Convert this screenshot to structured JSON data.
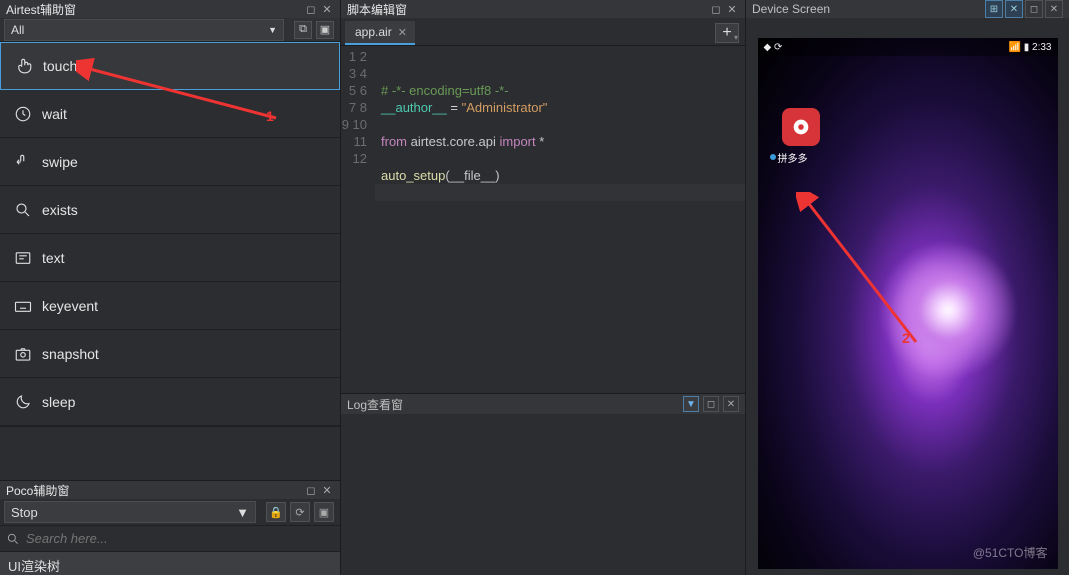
{
  "airtest_panel": {
    "title": "Airtest辅助窗",
    "filter": "All"
  },
  "commands": [
    {
      "name": "touch",
      "icon": "touch"
    },
    {
      "name": "wait",
      "icon": "clock"
    },
    {
      "name": "swipe",
      "icon": "swipe"
    },
    {
      "name": "exists",
      "icon": "search"
    },
    {
      "name": "text",
      "icon": "text"
    },
    {
      "name": "keyevent",
      "icon": "keyboard"
    },
    {
      "name": "snapshot",
      "icon": "camera"
    },
    {
      "name": "sleep",
      "icon": "moon"
    }
  ],
  "poco_panel": {
    "title": "Poco辅助窗",
    "mode": "Stop",
    "search_placeholder": "Search here...",
    "tree_label": "UI渲染树"
  },
  "script_panel": {
    "title": "脚本编辑窗",
    "tab": "app.air"
  },
  "code": {
    "l1_a": "# -*- encoding=utf8 -*-",
    "l2_a": "__author__",
    "l2_b": " = ",
    "l2_c": "\"Administrator\"",
    "l4_a": "from",
    "l4_b": " airtest.core.api ",
    "l4_c": "import",
    "l4_d": " *",
    "l6_a": "auto_setup",
    "l6_b": "(__file__)"
  },
  "line_numbers": [
    "1",
    "2",
    "3",
    "4",
    "5",
    "6",
    "7",
    "8",
    "9",
    "10",
    "11",
    "12"
  ],
  "log_panel": {
    "title": "Log查看窗"
  },
  "device_panel": {
    "title": "Device Screen",
    "status_time": "2:33",
    "app_name": "拼多多",
    "watermark": "@51CTO博客"
  },
  "annotations": {
    "one": "1",
    "two": "2"
  }
}
